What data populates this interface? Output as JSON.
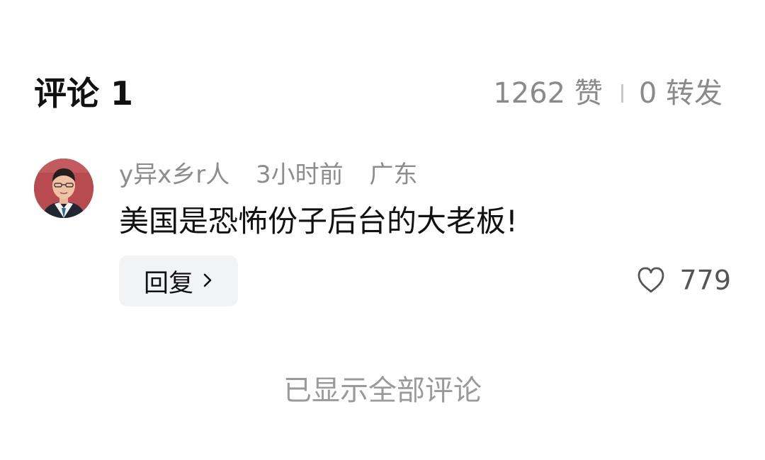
{
  "header": {
    "title": "评论 1",
    "likes": "1262 赞",
    "shares": "0 转发"
  },
  "comment": {
    "username": "y异x乡r人",
    "time": "3小时前",
    "location": "广东",
    "text": "美国是恐怖份子后台的大老板!",
    "reply_label": "回复",
    "like_count": "779",
    "icons": {
      "avatar": "user-avatar",
      "reply_chevron": "chevron-right-icon",
      "like": "heart-icon"
    }
  },
  "footer": {
    "note": "已显示全部评论"
  },
  "colors": {
    "primary_text": "#111111",
    "secondary_text": "#8d8d8d",
    "reply_bg": "#f2f3f5",
    "avatar_bg": "#b24a4d"
  }
}
